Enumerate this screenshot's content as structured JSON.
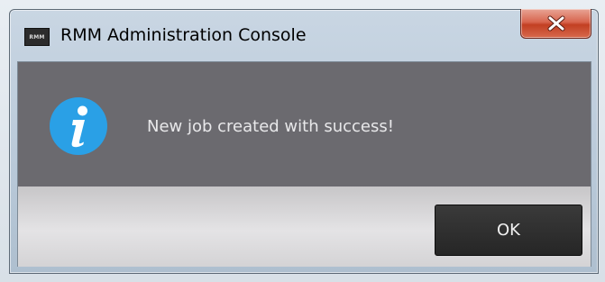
{
  "window": {
    "title": "RMM Administration Console",
    "app_icon_text": "RMM",
    "close_icon": "close-x-icon"
  },
  "dialog": {
    "icon": "info-icon",
    "message": "New job created with success!",
    "ok_label": "OK"
  },
  "colors": {
    "message_background": "#6b6a6f",
    "message_text": "#e8e8ea",
    "info_icon": "#2aa0e6",
    "ok_button": "#262626",
    "close_button": "#c23f22"
  }
}
